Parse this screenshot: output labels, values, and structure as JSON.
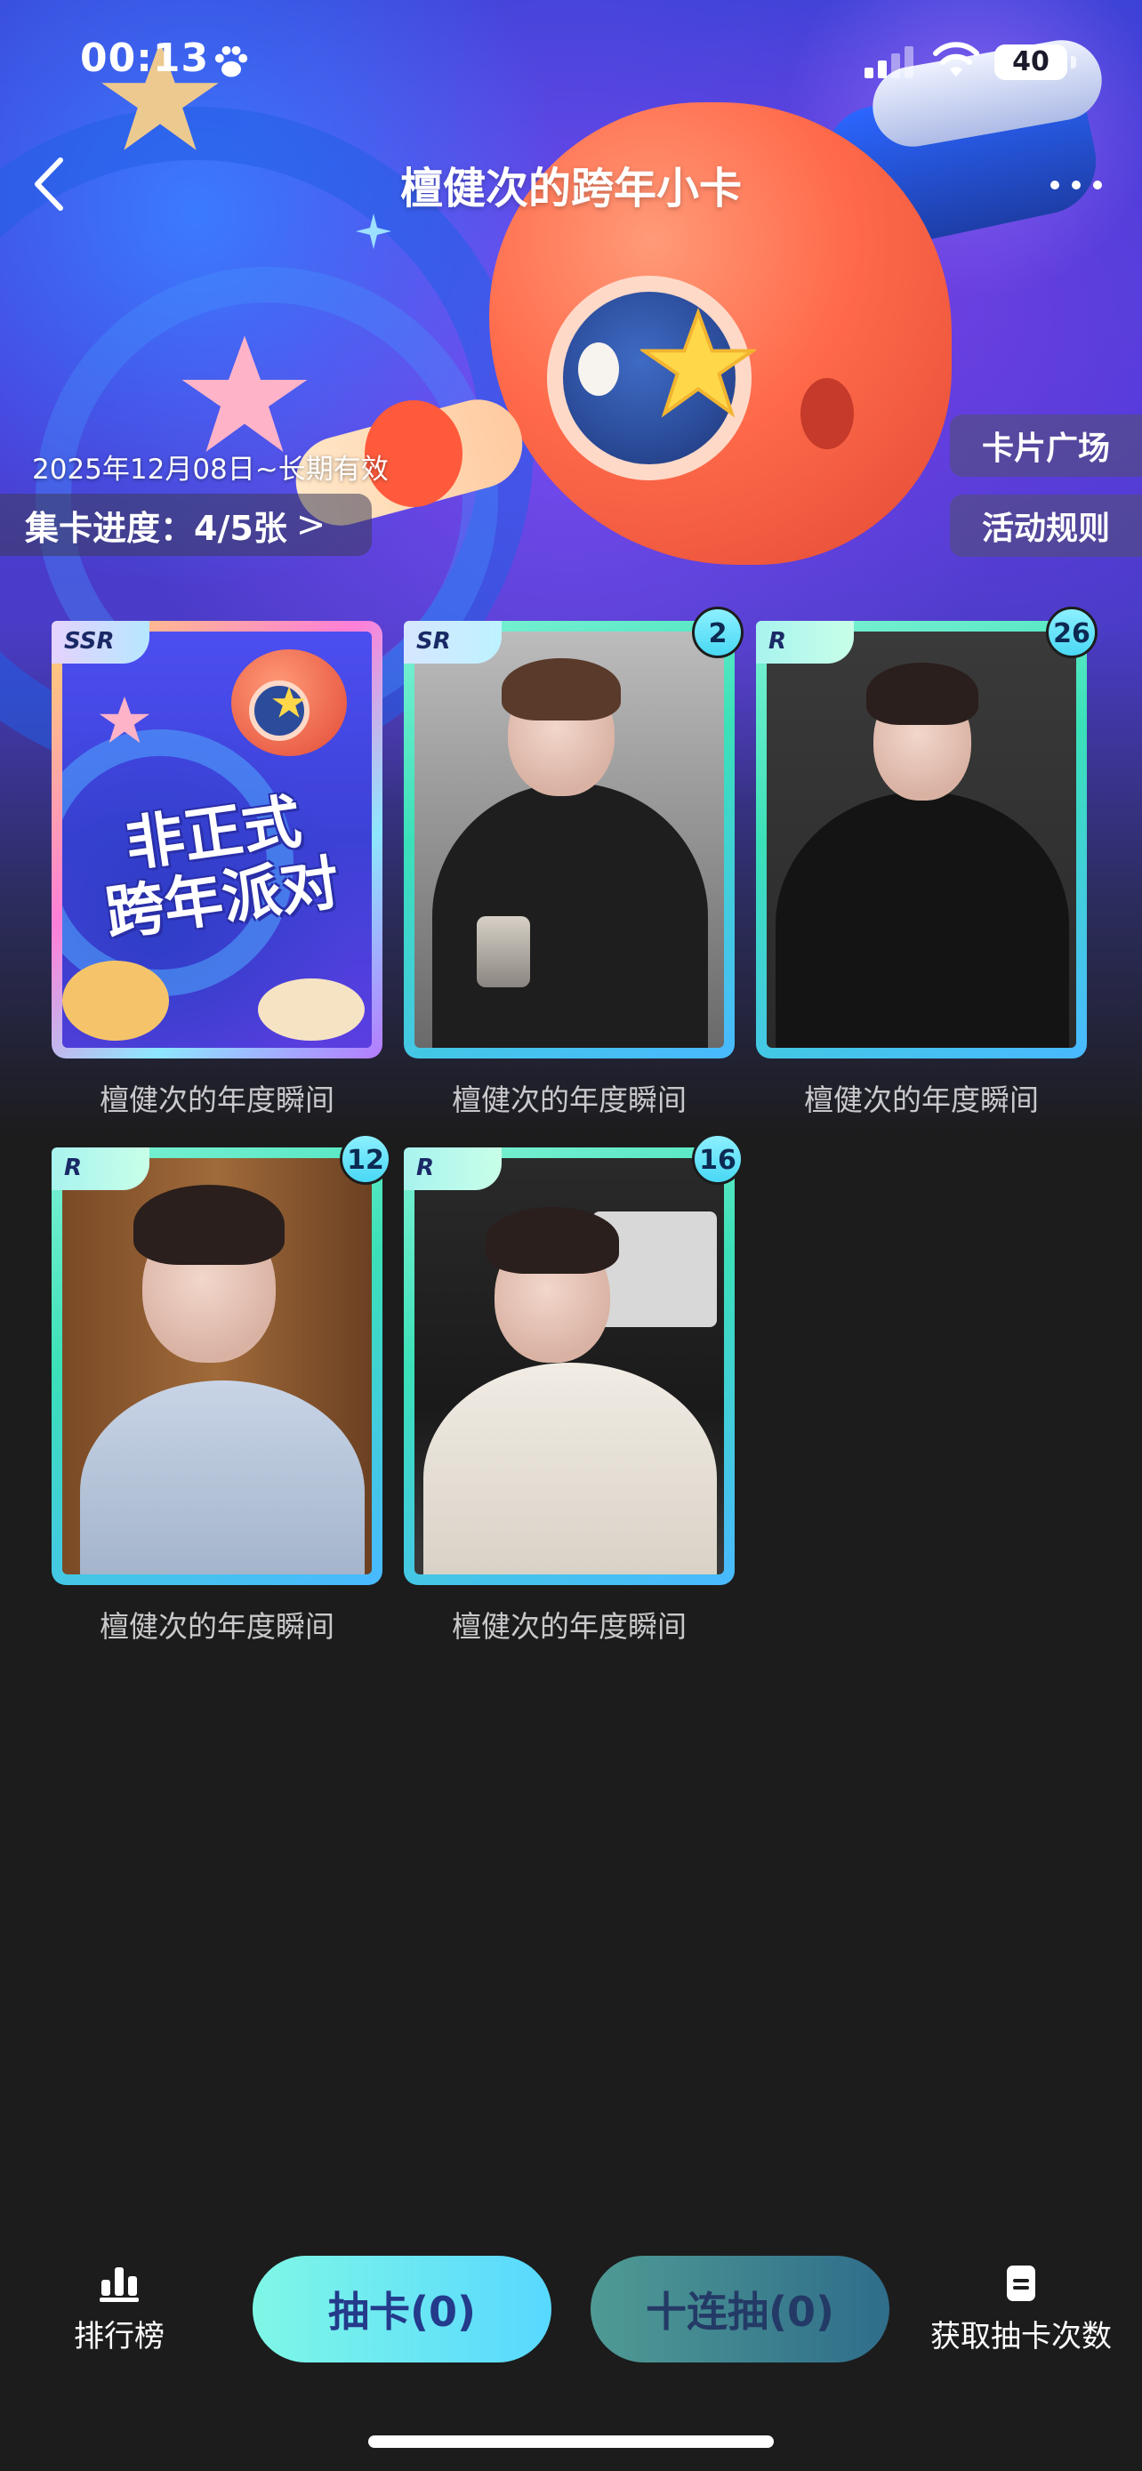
{
  "status_bar": {
    "time": "00:13",
    "battery": "40"
  },
  "header": {
    "title": "檀健次的跨年小卡"
  },
  "banner": {
    "valid_date": "2025年12月08日~长期有效",
    "progress_label": "集卡进度：4/5张",
    "progress_chevron": ">",
    "card_square_label": "卡片广场",
    "rules_label": "活动规则",
    "artwork_text_line1": "非正式",
    "artwork_text_line2": "跨年派对"
  },
  "cards": [
    {
      "rarity": "SSR",
      "count": "",
      "label": "檀健次的年度瞬间"
    },
    {
      "rarity": "SR",
      "count": "2",
      "label": "檀健次的年度瞬间"
    },
    {
      "rarity": "R",
      "count": "26",
      "label": "檀健次的年度瞬间"
    },
    {
      "rarity": "R",
      "count": "12",
      "label": "檀健次的年度瞬间"
    },
    {
      "rarity": "R",
      "count": "16",
      "label": "檀健次的年度瞬间"
    }
  ],
  "bottom_bar": {
    "leaderboard_label": "排行榜",
    "draw_label": "抽卡(0)",
    "ten_draw_label": "十连抽(0)",
    "get_draws_label": "获取抽卡次数"
  },
  "colors": {
    "background": "#1c1c1c",
    "accent_cyan": "#58d8ff",
    "accent_mint": "#7ff7e6",
    "mascot_red": "#ff6a4a"
  }
}
